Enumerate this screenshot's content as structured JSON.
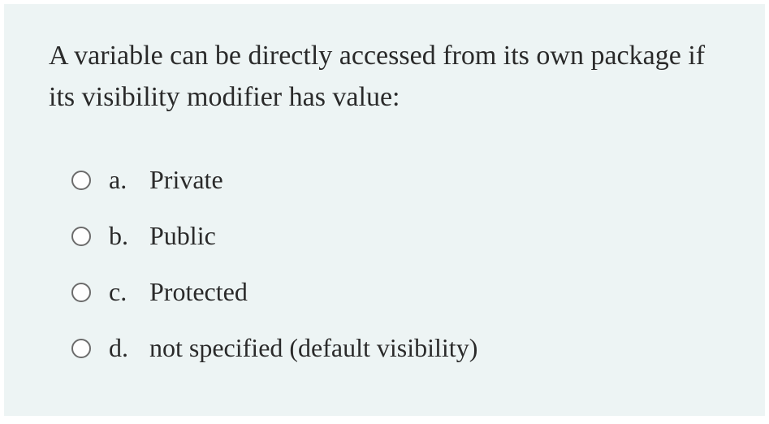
{
  "question": {
    "text": "A variable can be directly accessed from its own package if its visibility modifier has value:",
    "options": [
      {
        "letter": "a.",
        "label": "Private"
      },
      {
        "letter": "b.",
        "label": "Public"
      },
      {
        "letter": "c.",
        "label": "Protected"
      },
      {
        "letter": "d.",
        "label": "not specified (default visibility)"
      }
    ]
  }
}
